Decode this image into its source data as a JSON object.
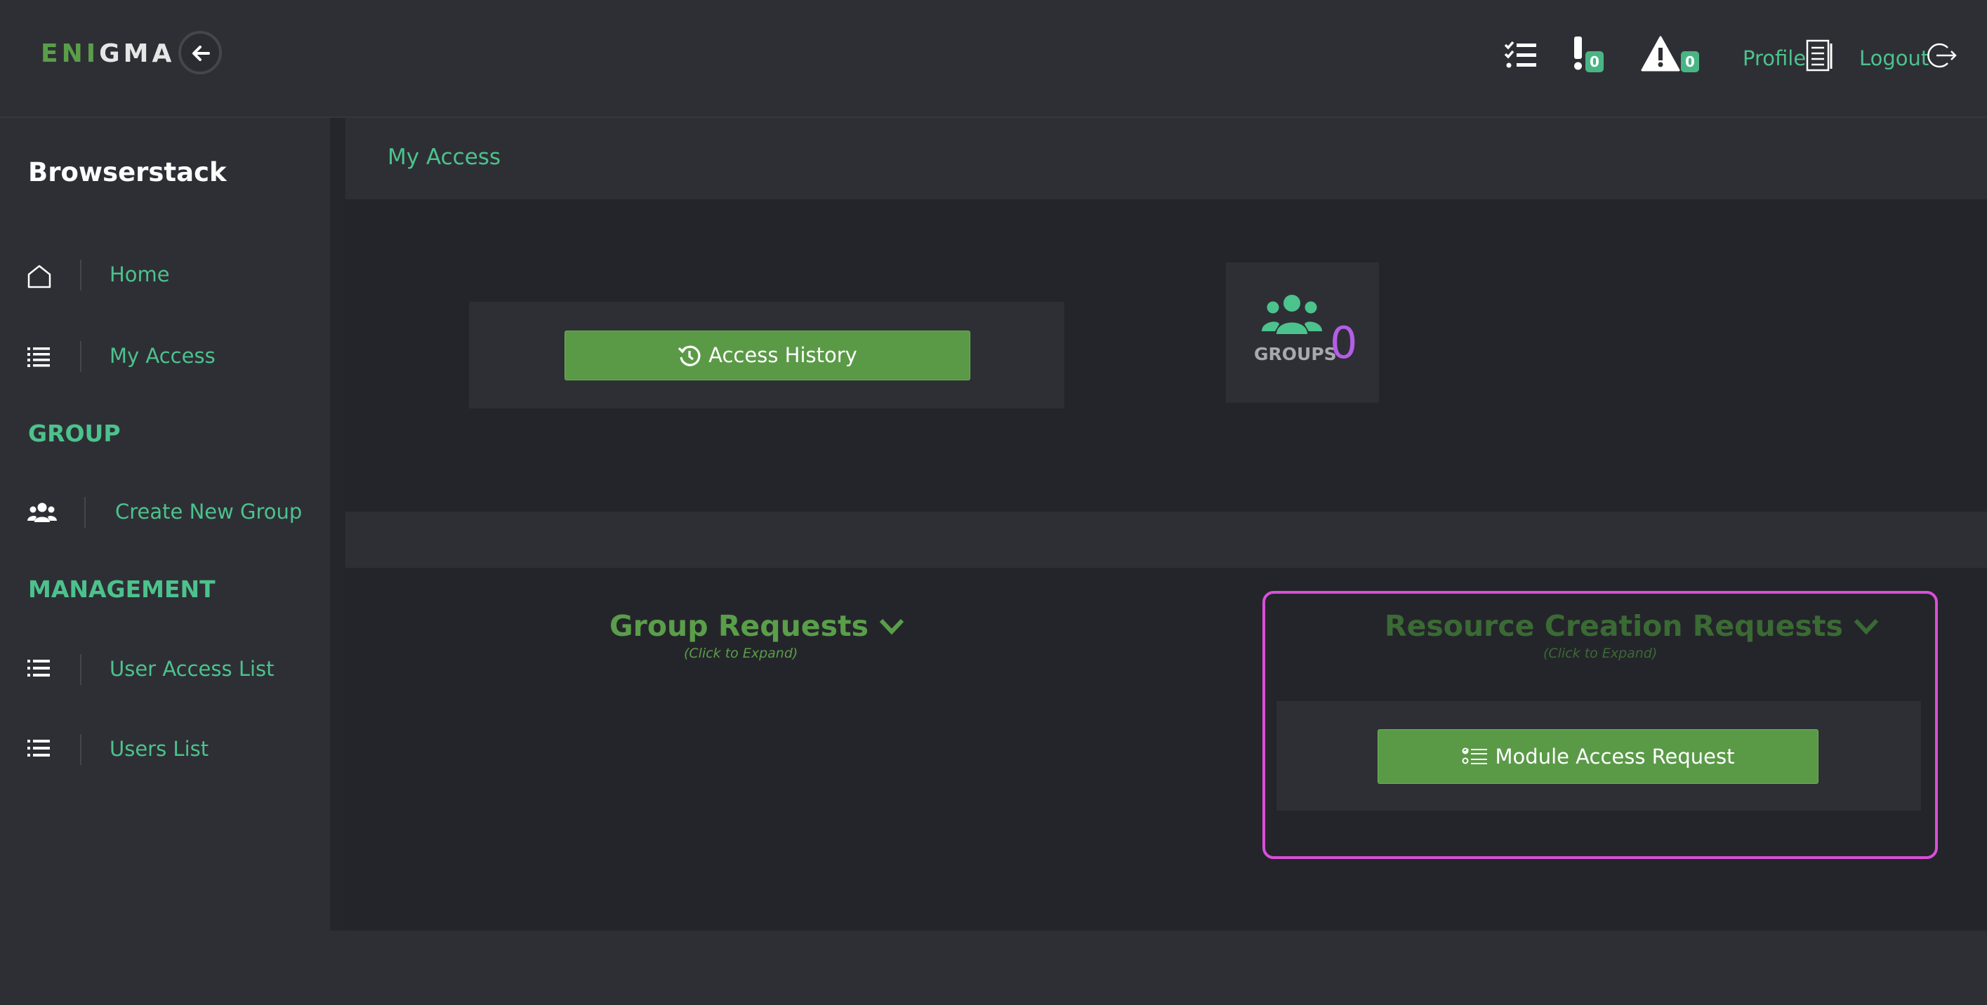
{
  "app": {
    "logo_part1": "ENI",
    "logo_part2": "GMA",
    "org_name": "Browserstack"
  },
  "topbar": {
    "tasks_icon": "task-list-icon",
    "alerts_count": "0",
    "warnings_count": "0",
    "profile_label": "Profile",
    "logout_label": "Logout"
  },
  "sidebar": {
    "home_label": "Home",
    "my_access_label": "My Access",
    "group_section": "GROUP",
    "create_group_label": "Create New Group",
    "management_section": "MANAGEMENT",
    "user_access_list_label": "User Access List",
    "users_list_label": "Users List"
  },
  "main": {
    "title": "My Access",
    "access_history_label": "Access History",
    "groups_label": "GROUPS",
    "groups_count": "0",
    "group_requests_title": "Group Requests",
    "group_requests_hint": "(Click to Expand)",
    "resource_requests_title": "Resource Creation Requests",
    "resource_requests_hint": "(Click to Expand)",
    "module_access_label": "Module Access Request"
  },
  "colors": {
    "accent_green": "#4cc28d",
    "button_green": "#5a9a47",
    "highlight_magenta": "#d94fd9",
    "count_purple": "#b35ee6"
  }
}
